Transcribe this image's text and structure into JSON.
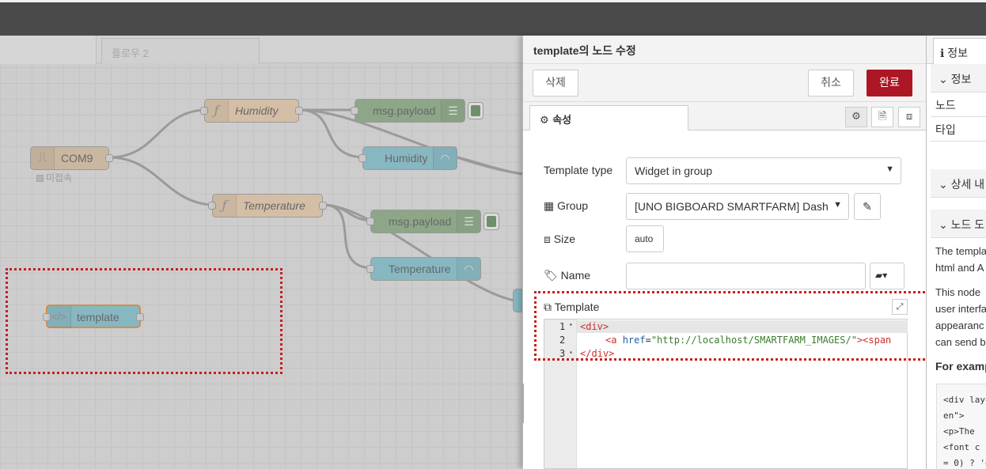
{
  "workspace": {
    "tabs": [
      {
        "label": ""
      },
      {
        "label": "플로우 2"
      }
    ],
    "nodes": {
      "com9": {
        "label": "COM9",
        "status": "미접속"
      },
      "humidity_fn": {
        "label": "Humidity"
      },
      "humidity_debug": {
        "label": "msg.payload"
      },
      "humidity_gauge": {
        "label": "Humidity"
      },
      "temperature_fn": {
        "label": "Temperature"
      },
      "temperature_debug": {
        "label": "msg.payload"
      },
      "temperature_gauge": {
        "label": "Temperature"
      },
      "template": {
        "label": "template"
      }
    },
    "colors": {
      "function": "#e6c9a8",
      "debug": "#87a980",
      "gauge": "#7fbfcc",
      "serial": "#d8bfa0",
      "highlight": "#c42020"
    }
  },
  "tray": {
    "title": "template의 노드 수정",
    "delete_label": "삭제",
    "cancel_label": "취소",
    "done_label": "완료",
    "tab_label": "속성",
    "icons": [
      "gear-icon",
      "document-icon",
      "frame-icon"
    ],
    "fields": {
      "template_type_label": "Template type",
      "template_type_value": "Widget in group",
      "group_label": "Group",
      "group_value": "[UNO BIGBOARD SMARTFARM] Dash",
      "size_label": "Size",
      "size_value": "auto",
      "name_label": "Name",
      "name_value": "",
      "template_label": "Template"
    },
    "code": {
      "line_numbers": [
        "1",
        "2",
        "3"
      ],
      "line1": "<div>",
      "line2_open": "<a ",
      "line2_attr": "href",
      "line2_eq": "=",
      "line2_str": "\"http://localhost/SMARTFARM_IMAGES/\"",
      "line2_close": "><span",
      "line3": "</div>"
    }
  },
  "sidebar": {
    "tab_label": "정보",
    "info_section": "정보",
    "row_node": "노드",
    "row_type": "타입",
    "detail_section": "상세 내",
    "node_help_section": "노드 도",
    "help_lines": [
      "The templa",
      "html and A"
    ],
    "help_lines2": [
      "This node",
      "user interfa",
      "appearanc",
      "can send b"
    ],
    "example_heading": "For examp",
    "pre_lines": [
      "<div layo",
      "en\">",
      "  <p>The",
      "  <font c",
      "= 0) ? 'g"
    ]
  }
}
